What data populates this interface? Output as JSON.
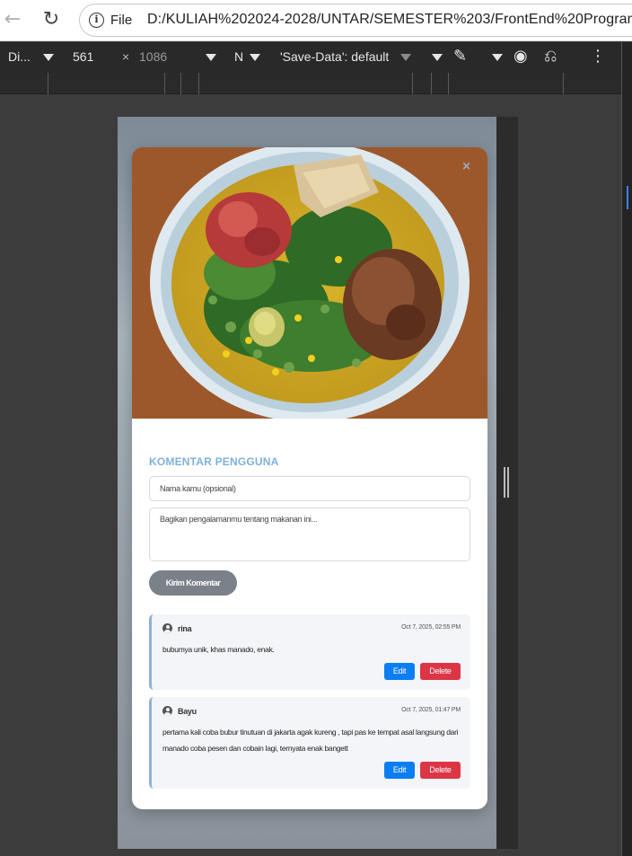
{
  "browser": {
    "file_label": "File",
    "url": "D:/KULIAH%202024-2028/UNTAR/SEMESTER%203/FrontEnd%20Programming"
  },
  "devtools": {
    "device": "Di...",
    "width": "561",
    "times": "×",
    "height": "1086",
    "zoom": "N",
    "save_data": "'Save-Data': default"
  },
  "modal": {
    "close": "×",
    "section_title": "KOMENTAR PENGGUNA",
    "name_placeholder": "Nama kamu (opsional)",
    "comment_placeholder": "Bagikan pengalamanmu tentang makanan ini...",
    "submit_label": "Kirim Komentar",
    "edit_label": "Edit",
    "delete_label": "Delete",
    "comments": [
      {
        "author": "rina",
        "date": "Oct 7, 2025, 02:55 PM",
        "text": "bubumya unik, khas manado, enak."
      },
      {
        "author": "Bayu",
        "date": "Oct 7, 2025, 01:47 PM",
        "text": "pertama kali coba bubur tinutuan di jakarta agak kureng , tapi pas ke tempat asal langsung dari manado coba pesen dan cobain lagi, ternyata enak bangett"
      }
    ]
  }
}
